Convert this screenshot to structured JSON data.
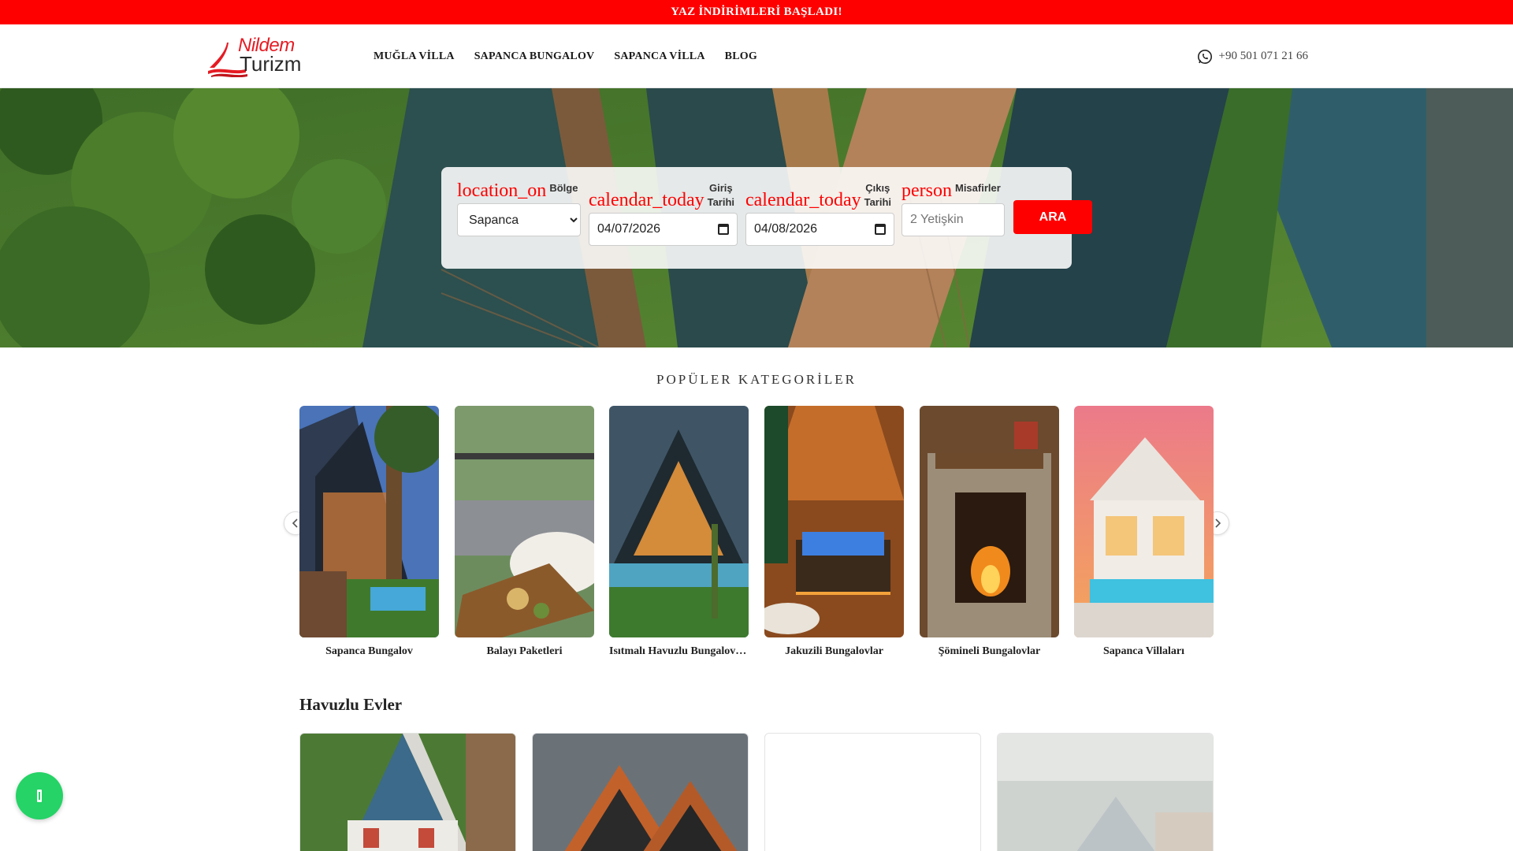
{
  "banner": {
    "text": "YAZ İNDİRİMLERİ BAŞLADI!"
  },
  "logo": {
    "line1": "Nildem",
    "line2": "Turizm"
  },
  "nav": {
    "items": [
      {
        "label": "MUĞLA VİLLA"
      },
      {
        "label": "SAPANCA BUNGALOV"
      },
      {
        "label": "SAPANCA VİLLA"
      },
      {
        "label": "BLOG"
      }
    ]
  },
  "contact": {
    "phone": "+90 501 071 21 66",
    "icon": "whatsapp-icon"
  },
  "search": {
    "region": {
      "icon_text": "location_on",
      "label": "Bölge",
      "value": "Sapanca"
    },
    "checkin": {
      "icon_text": "calendar_today",
      "label_line1": "Giriş",
      "label_line2": "Tarihi",
      "value": "04/07/2026"
    },
    "checkout": {
      "icon_text": "calendar_today",
      "label_line1": "Çıkış",
      "label_line2": "Tarihi",
      "value": "04/08/2026"
    },
    "guests": {
      "icon_text": "person",
      "label": "Misafirler",
      "placeholder": "2 Yetişkin"
    },
    "submit_label": "ARA"
  },
  "categories": {
    "title": "POPÜLER KATEGORİLER",
    "items": [
      {
        "name": "Sapanca Bungalov"
      },
      {
        "name": "Balayı Paketleri"
      },
      {
        "name": "Isıtmalı Havuzlu Bungalovlar"
      },
      {
        "name": "Jakuzili Bungalovlar"
      },
      {
        "name": "Şömineli Bungalovlar"
      },
      {
        "name": "Sapanca Villaları"
      }
    ]
  },
  "pool_homes": {
    "title": "Havuzlu Evler"
  },
  "colors": {
    "accent": "#ff0000",
    "whatsapp": "#25d366"
  }
}
